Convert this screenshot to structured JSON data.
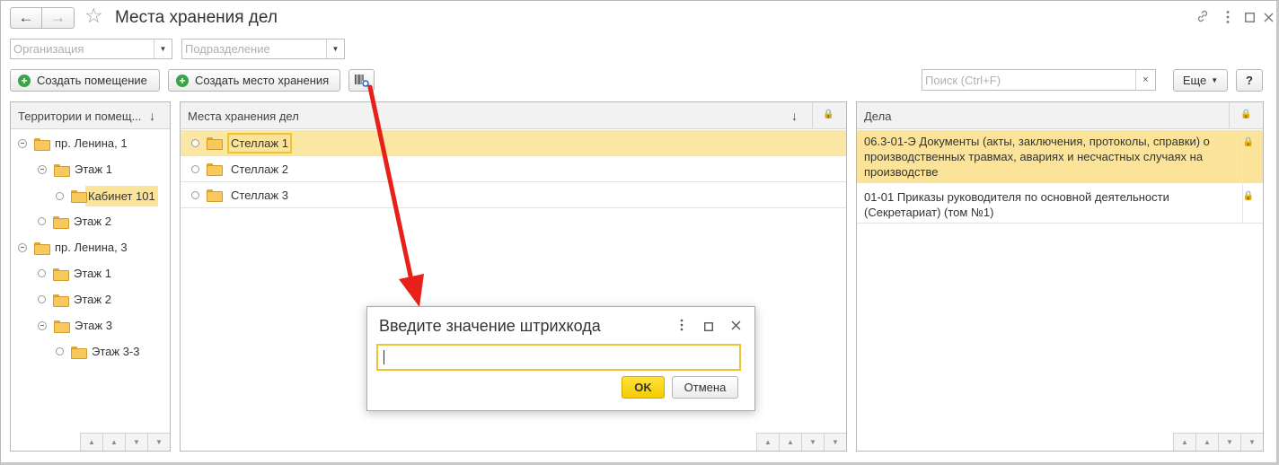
{
  "window": {
    "title": "Места хранения дел",
    "back_icon": "arrow-left",
    "forward_icon": "arrow-right",
    "favorite_icon": "star",
    "link_icon": "link",
    "menu_icon": "more-vertical",
    "maximize_icon": "square",
    "close_icon": "close"
  },
  "filters": {
    "organization_placeholder": "Организация",
    "department_placeholder": "Подразделение"
  },
  "toolbar": {
    "create_room_label": "Создать помещение",
    "create_storage_label": "Создать место хранения",
    "barcode_icon": "barcode-search",
    "search_placeholder": "Поиск (Ctrl+F)",
    "search_clear": "×",
    "more_label": "Еще",
    "help_label": "?"
  },
  "territories": {
    "header": "Территории и помещ...",
    "items": [
      {
        "label": "пр. Ленина, 1"
      },
      {
        "label": "Этаж 1"
      },
      {
        "label": "Кабинет 101"
      },
      {
        "label": "Этаж 2"
      },
      {
        "label": "пр. Ленина, 3"
      },
      {
        "label": "Этаж 1"
      },
      {
        "label": "Этаж 2"
      },
      {
        "label": "Этаж 3"
      },
      {
        "label": "Этаж 3-3"
      }
    ]
  },
  "storage": {
    "header": "Места хранения дел",
    "items": [
      {
        "label": "Стеллаж 1"
      },
      {
        "label": "Стеллаж 2"
      },
      {
        "label": "Стеллаж 3"
      }
    ]
  },
  "cases": {
    "header": "Дела",
    "items": [
      {
        "text": "06.3-01-Э Документы (акты, заключения, протоколы, справки) о производственных травмах, авариях и несчастных случаях на производстве"
      },
      {
        "text": "01-01 Приказы руководителя по основной деятельности (Секретариат) (том №1)"
      }
    ]
  },
  "dialog": {
    "title": "Введите значение штрихкода",
    "value": "",
    "ok_label": "OK",
    "cancel_label": "Отмена"
  },
  "colors": {
    "selection": "#fbe49a",
    "accent_yellow": "#f2c330",
    "arrow_red": "#e8201a",
    "folder": "#f7c95c"
  }
}
